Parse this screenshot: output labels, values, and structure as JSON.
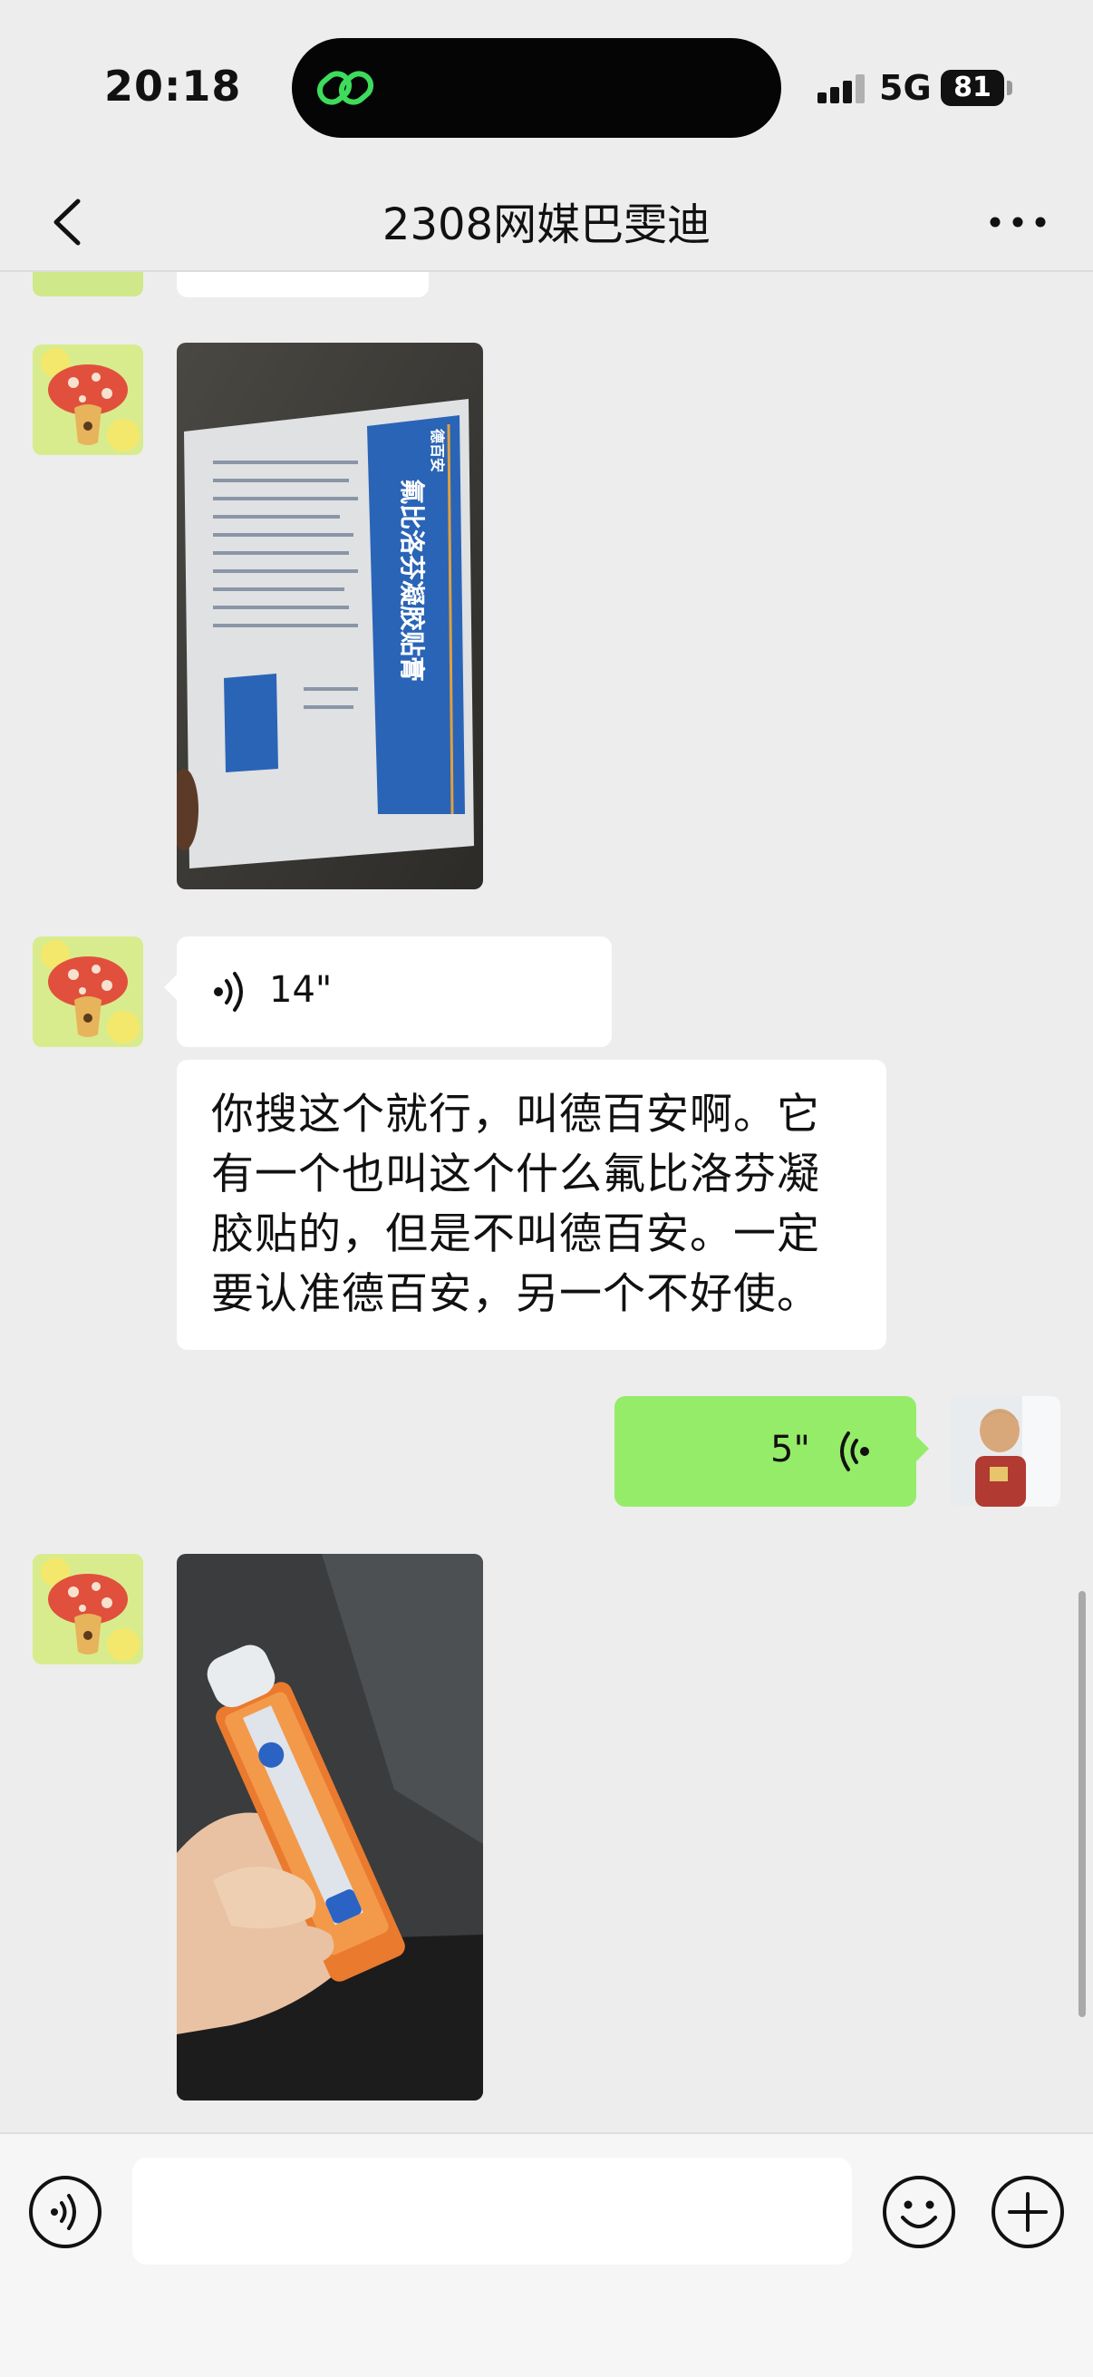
{
  "status_bar": {
    "time": "20:18",
    "network": "5G",
    "battery": "81",
    "island_icon": "link-rings-icon"
  },
  "header": {
    "title": "2308网媒巴雯迪",
    "back_icon": "chevron-left-icon",
    "more_icon": "more-dots-icon"
  },
  "messages": [
    {
      "type": "text",
      "side": "left",
      "partial": true
    },
    {
      "type": "image",
      "side": "left",
      "description_icon": "medicine-package-photo"
    },
    {
      "type": "voice",
      "side": "left",
      "duration": "14\""
    },
    {
      "type": "text",
      "side": "left",
      "text": "你搜这个就行，叫德百安啊。它有一个也叫这个什么氟比洛芬凝胶贴的，但是不叫德百安。一定要认准德百安，另一个不好使。"
    },
    {
      "type": "voice",
      "side": "right",
      "duration": "5\""
    },
    {
      "type": "image",
      "side": "left",
      "description_icon": "ointment-tube-photo"
    }
  ],
  "package_photo": {
    "brand": "德百安",
    "product": "氟比洛芬凝胶贴膏"
  },
  "input_bar": {
    "value": "",
    "placeholder": "",
    "voice_icon": "voice-mode-icon",
    "emoji_icon": "emoji-icon",
    "plus_icon": "plus-circle-icon"
  },
  "colors": {
    "background": "#ededed",
    "incoming_bubble": "#ffffff",
    "outgoing_bubble": "#95ec69"
  }
}
